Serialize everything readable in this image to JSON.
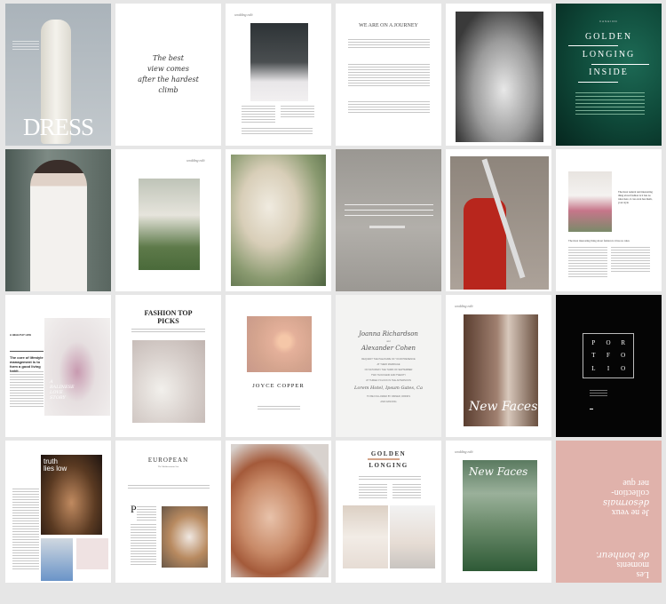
{
  "pages": {
    "p1": {
      "title": "DRESS"
    },
    "p2": {
      "quote_lines": [
        "The best",
        "view comes",
        "after the hardest",
        "climb"
      ]
    },
    "p3": {
      "header": "wedding edit"
    },
    "p4": {
      "title": "WE ARE ON A JOURNEY"
    },
    "p6": {
      "kicker": "FASHION",
      "lines": [
        "GOLDEN",
        "LONGING",
        "INSIDE"
      ]
    },
    "p8": {
      "header": "wedding edit"
    },
    "p12": {
      "quote": "The most natural and interesting thing about fashion is it has no rules here, it can even has them, your style",
      "subhead": "The most interesting thing about fashion is it has no rules"
    },
    "p13": {
      "kicker": "A HEALTHY LIFE",
      "headline": "The core of lifestyle management is to form a good living habit",
      "overlay": [
        "A",
        "BALINESE",
        "LOVE",
        "STORY"
      ]
    },
    "p14": {
      "title_lines": [
        "FASHION TOP",
        "PICKS"
      ]
    },
    "p15": {
      "name": "JOYCE COPPER"
    },
    "p16": {
      "name1": "Joanna Richardson",
      "and": "and",
      "name2": "Alexander Cohen",
      "lines": [
        "REQUEST THE PLEASURE OF YOUR PRESENCE",
        "AT THEIR MARRIAGE",
        "ON SATURDAY THE THIRD OF SEPTEMBER",
        "TWO THOUSAND AND TWENTY",
        "AT THREE O'CLOCK IN THE AFTERNOON"
      ],
      "venue": "Lorem Hotel, Ipsum Gates, Ca",
      "after": [
        "TO BE FOLLOWED BY DINNER, DRINKS",
        "AND DANCING"
      ]
    },
    "p17": {
      "header": "wedding edit",
      "overlay": "New Faces"
    },
    "p18": {
      "letters": [
        "P",
        "O",
        "R",
        "T",
        "F",
        "O",
        "L",
        "I",
        "O"
      ]
    },
    "p19": {
      "overlay": [
        "truth",
        "lies low"
      ]
    },
    "p20": {
      "title": "EUROPEAN",
      "subtitle": "The Mediterranean Sea",
      "dropcap": "P"
    },
    "p22": {
      "lines": [
        "GOLDEN",
        "LONGING"
      ]
    },
    "p23": {
      "header": "wedding edit",
      "overlay": "New Faces"
    },
    "p24": {
      "lines": [
        "Les",
        "moments",
        "de bonheur.",
        "Je ne veux",
        "désormais",
        "collection-",
        "ner que"
      ]
    }
  },
  "colors": {
    "background": "#e6e6e6",
    "green": "#0f4a3a",
    "pink": "#e0b2ab",
    "black": "#050505",
    "gold": "#d4a58a"
  }
}
